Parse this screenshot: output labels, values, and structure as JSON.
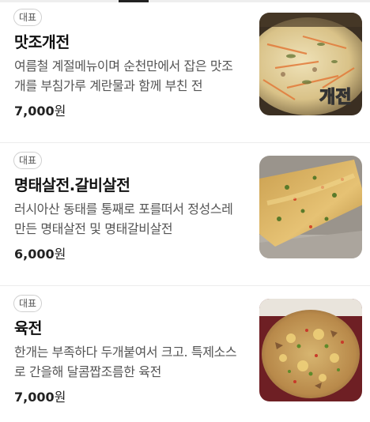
{
  "menu": {
    "items": [
      {
        "badge": "대표",
        "name": "맛조개전",
        "description": "여름철 계절메뉴이며 순천만에서 잡은 맛조개를 부침가루 계란물과 함께 부친 전",
        "price_number": "7,000",
        "price_unit": "원",
        "photo_caption": "개전"
      },
      {
        "badge": "대표",
        "name": "명태살전.갈비살전",
        "description": "러시아산 동태를 통째로 포를떠서 정성스레 만든 명태살전 및 명태갈비살전",
        "price_number": "6,000",
        "price_unit": "원"
      },
      {
        "badge": "대표",
        "name": "육전",
        "description": "한개는 부족하다 두개붙여서 크고. 특제소스로 간을해 달콤짭조름한 육전",
        "price_number": "7,000",
        "price_unit": "원"
      }
    ]
  }
}
